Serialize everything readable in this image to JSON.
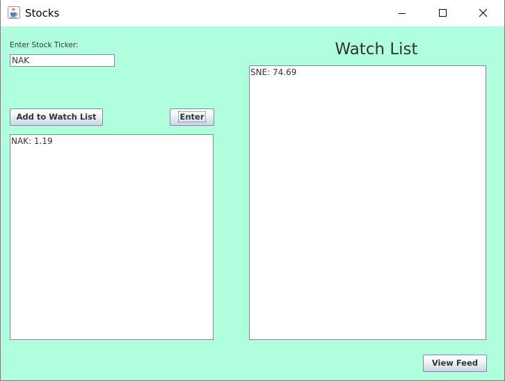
{
  "window": {
    "title": "Stocks",
    "icon": "java-cup-icon",
    "controls": [
      "minimize-icon",
      "maximize-icon",
      "close-icon"
    ],
    "background_color": "#afffdf"
  },
  "ticker_form": {
    "label": "Enter Stock Ticker:",
    "input_value": "NAK",
    "add_button_label": "Add to Watch List",
    "enter_button_label": "Enter"
  },
  "results": {
    "lines": [
      "NAK: 1.19"
    ]
  },
  "watch_list": {
    "title": "Watch List",
    "lines": [
      "SNE: 74.69"
    ]
  },
  "footer": {
    "view_feed_label": "View Feed"
  }
}
